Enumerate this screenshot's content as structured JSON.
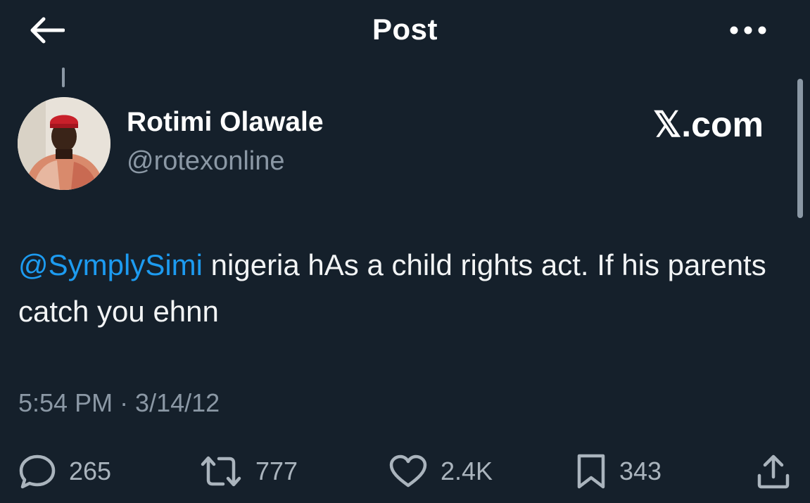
{
  "header": {
    "title": "Post",
    "back_icon": "arrow-left-icon",
    "more_icon": "more-dots-icon"
  },
  "tweet": {
    "author": {
      "display_name": "Rotimi Olawale",
      "handle": "@rotexonline"
    },
    "watermark": "𝕏.com",
    "mention": "@SymplySimi",
    "text": " nigeria hAs a child rights act. If his parents catch you ehnn",
    "timestamp": "5:54 PM · 3/14/12"
  },
  "actions": {
    "replies": "265",
    "reposts": "777",
    "likes": "2.4K",
    "bookmarks": "343"
  },
  "colors": {
    "background": "#15202b",
    "text": "#ffffff",
    "secondary": "#8b98a5",
    "link": "#1d9bf0"
  }
}
